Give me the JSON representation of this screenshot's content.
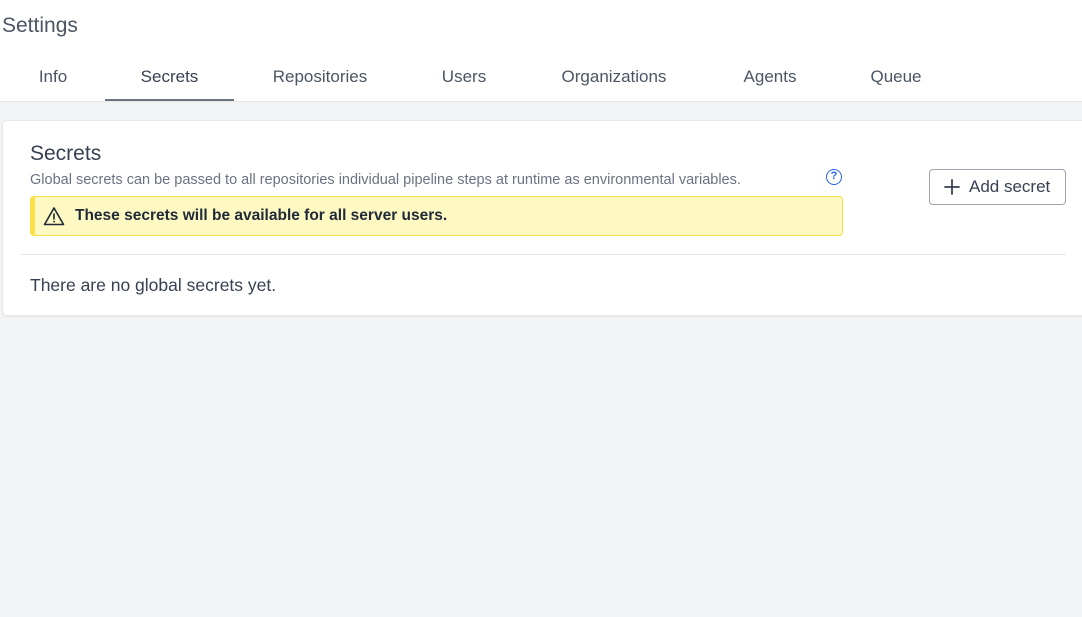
{
  "page": {
    "title": "Settings"
  },
  "tabs": [
    {
      "label": "Info",
      "active": false
    },
    {
      "label": "Secrets",
      "active": true
    },
    {
      "label": "Repositories",
      "active": false
    },
    {
      "label": "Users",
      "active": false
    },
    {
      "label": "Organizations",
      "active": false
    },
    {
      "label": "Agents",
      "active": false
    },
    {
      "label": "Queue",
      "active": false
    }
  ],
  "secrets": {
    "title": "Secrets",
    "description": "Global secrets can be passed to all repositories individual pipeline steps at runtime as environmental variables.",
    "help_icon": "?",
    "warning": "These secrets will be available for all server users.",
    "add_label": "Add secret",
    "empty_text": "There are no global secrets yet."
  },
  "icons": {
    "help": "question-circle-icon",
    "warning": "warning-triangle-icon",
    "add": "plus-icon"
  },
  "colors": {
    "accent": "#2563eb",
    "warning_bg": "#fef9c3",
    "warning_border": "#fde047",
    "page_bg": "#f3f4f6"
  }
}
